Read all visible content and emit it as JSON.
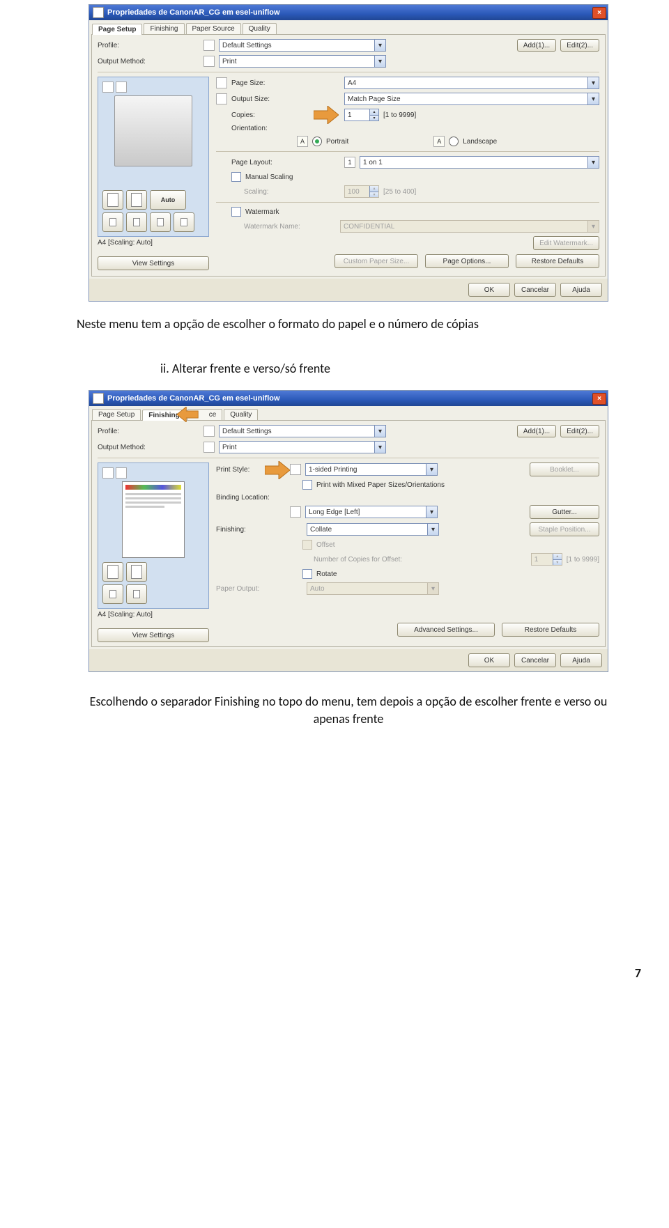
{
  "document": {
    "caption1": "Neste menu tem a opção de escolher o formato do papel e o número de cópias",
    "list_item_ii": "ii.    Alterar frente e verso/só frente",
    "caption2": "Escolhendo o separador Finishing no topo do menu, tem depois a opção de escolher frente e verso ou apenas frente",
    "page_number": "7"
  },
  "dialog1": {
    "title": "Propriedades de CanonAR_CG em esel-uniflow",
    "tabs": [
      "Page Setup",
      "Finishing",
      "Paper Source",
      "Quality"
    ],
    "active_tab": 0,
    "profile_label": "Profile:",
    "profile_value": "Default Settings",
    "btn_add": "Add(1)...",
    "btn_edit": "Edit(2)...",
    "output_label": "Output Method:",
    "output_value": "Print",
    "page_size_label": "Page Size:",
    "page_size_value": "A4",
    "output_size_label": "Output Size:",
    "output_size_value": "Match Page Size",
    "copies_label": "Copies:",
    "copies_value": "1",
    "copies_range": "[1 to 9999]",
    "orientation_label": "Orientation:",
    "portrait_label": "Portrait",
    "landscape_label": "Landscape",
    "page_layout_label": "Page Layout:",
    "page_layout_value": "1 on 1",
    "manual_scaling_label": "Manual Scaling",
    "scaling_label": "Scaling:",
    "scaling_value": "100",
    "scaling_range": "[25 to 400]",
    "watermark_label": "Watermark",
    "watermark_name_label": "Watermark Name:",
    "watermark_value": "CONFIDENTIAL",
    "btn_edit_watermark": "Edit Watermark...",
    "btn_custom_paper": "Custom Paper Size...",
    "btn_page_options": "Page Options...",
    "btn_restore": "Restore Defaults",
    "preview_caption": "A4 [Scaling: Auto]",
    "btn_view_settings": "View Settings",
    "tool_auto": "Auto",
    "btn_ok": "OK",
    "btn_cancel": "Cancelar",
    "btn_help": "Ajuda"
  },
  "dialog2": {
    "title": "Propriedades de CanonAR_CG em esel-uniflow",
    "tabs": [
      "Page Setup",
      "Finishing",
      "ce",
      "Quality"
    ],
    "active_tab": 1,
    "profile_label": "Profile:",
    "profile_value": "Default Settings",
    "btn_add": "Add(1)...",
    "btn_edit": "Edit(2)...",
    "output_label": "Output Method:",
    "output_value": "Print",
    "print_style_label": "Print Style:",
    "print_style_value": "1-sided Printing",
    "btn_booklet": "Booklet...",
    "mixed_label": "Print with Mixed Paper Sizes/Orientations",
    "binding_label": "Binding Location:",
    "binding_value": "Long Edge [Left]",
    "btn_gutter": "Gutter...",
    "finishing_label": "Finishing:",
    "finishing_value": "Collate",
    "btn_staple": "Staple Position...",
    "offset_label": "Offset",
    "num_copies_offset_label": "Number of Copies for Offset:",
    "num_copies_offset_value": "1",
    "num_copies_offset_range": "[1 to 9999]",
    "rotate_label": "Rotate",
    "paper_output_label": "Paper Output:",
    "paper_output_value": "Auto",
    "preview_caption": "A4 [Scaling: Auto]",
    "btn_view_settings": "View Settings",
    "btn_advanced": "Advanced Settings...",
    "btn_restore": "Restore Defaults",
    "btn_ok": "OK",
    "btn_cancel": "Cancelar",
    "btn_help": "Ajuda"
  }
}
